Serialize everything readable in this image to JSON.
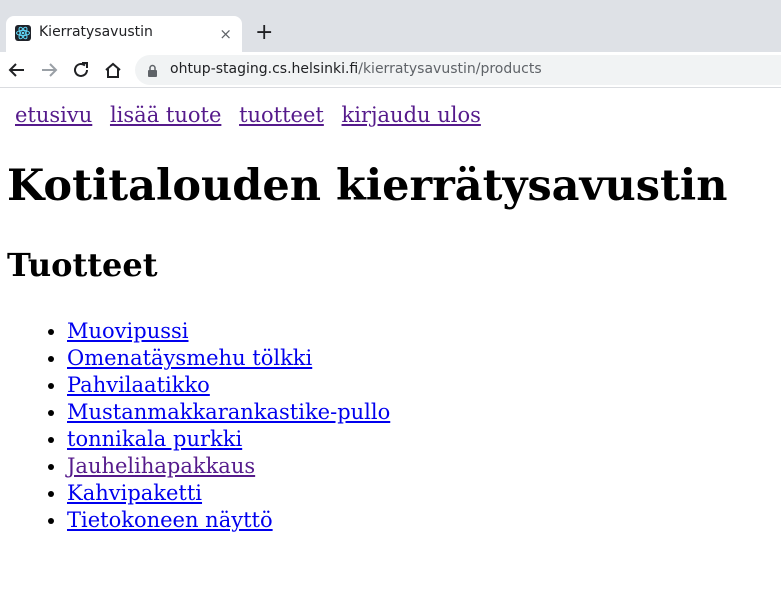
{
  "browser": {
    "tab_title": "Kierratysavustin",
    "tab_close": "×",
    "new_tab": "+",
    "url_host": "ohtup-staging.cs.helsinki.fi",
    "url_path": "/kierratysavustin/products",
    "icons": [
      "back-icon",
      "forward-icon",
      "reload-icon",
      "home-icon",
      "lock-icon",
      "react-favicon"
    ]
  },
  "nav": {
    "home": "etusivu",
    "add_product": "lisää tuote",
    "products": "tuotteet",
    "logout": "kirjaudu ulos"
  },
  "page": {
    "title": "Kotitalouden kierrätysavustin",
    "subtitle": "Tuotteet"
  },
  "products": [
    {
      "name": "Muovipussi",
      "visited": false
    },
    {
      "name": "Omenatäysmehu tölkki",
      "visited": false
    },
    {
      "name": "Pahvilaatikko",
      "visited": false
    },
    {
      "name": "Mustanmakkarankastike-pullo",
      "visited": false
    },
    {
      "name": "tonnikala purkki",
      "visited": false
    },
    {
      "name": "Jauhelihapakkaus",
      "visited": true
    },
    {
      "name": "Kahvipaketti",
      "visited": false
    },
    {
      "name": "Tietokoneen näyttö",
      "visited": false
    }
  ],
  "colors": {
    "link": "#0000ee",
    "visited_link": "#551a8b",
    "tabstrip": "#dee1e6"
  }
}
